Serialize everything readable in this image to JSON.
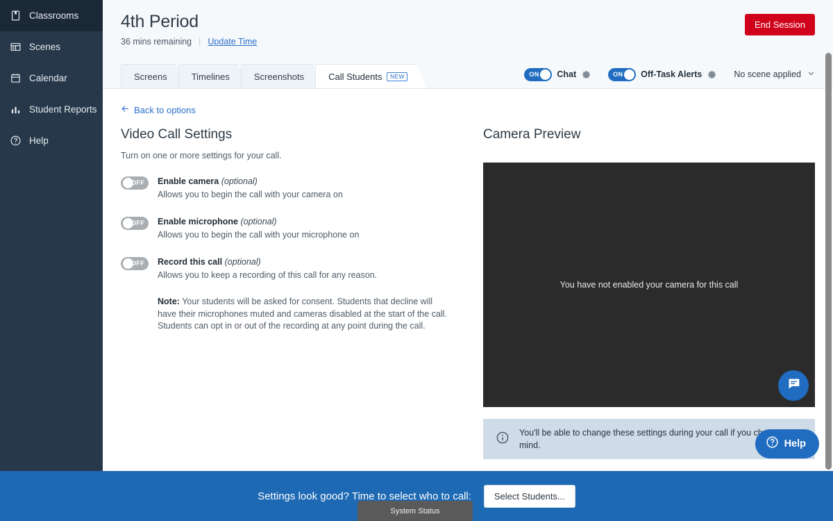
{
  "sidebar": {
    "items": [
      {
        "label": "Classrooms",
        "icon": "book-icon",
        "active": true
      },
      {
        "label": "Scenes",
        "icon": "scenes-icon",
        "active": false
      },
      {
        "label": "Calendar",
        "icon": "calendar-icon",
        "active": false
      },
      {
        "label": "Student Reports",
        "icon": "bar-chart-icon",
        "active": false
      },
      {
        "label": "Help",
        "icon": "question-circle-icon",
        "active": false
      }
    ]
  },
  "header": {
    "title": "4th Period",
    "time_remaining": "36 mins remaining",
    "separator": "|",
    "update_time_label": "Update Time",
    "end_session_label": "End Session"
  },
  "tabs": [
    {
      "label": "Screens",
      "active": false,
      "badge": ""
    },
    {
      "label": "Timelines",
      "active": false,
      "badge": ""
    },
    {
      "label": "Screenshots",
      "active": false,
      "badge": ""
    },
    {
      "label": "Call Students",
      "active": true,
      "badge": "NEW"
    }
  ],
  "tabbar_controls": {
    "chat_toggle": {
      "state": "ON",
      "label": "Chat",
      "on": true
    },
    "offtask_toggle": {
      "state": "ON",
      "label": "Off-Task Alerts",
      "on": true
    },
    "scene_select": {
      "value": "No scene applied",
      "caret": "chevron-down-icon"
    }
  },
  "content": {
    "back_link": "Back to options",
    "left": {
      "title": "Video Call Settings",
      "subtitle": "Turn on one or more settings for your call.",
      "settings": [
        {
          "toggle_state": "OFF",
          "on": false,
          "title": "Enable camera",
          "optional": "(optional)",
          "description": "Allows you to begin the call with your camera on"
        },
        {
          "toggle_state": "OFF",
          "on": false,
          "title": "Enable microphone",
          "optional": "(optional)",
          "description": "Allows you to begin the call with your microphone on"
        },
        {
          "toggle_state": "OFF",
          "on": false,
          "title": "Record this call",
          "optional": "(optional)",
          "description": "Allows you to keep a recording of this call for any reason."
        }
      ],
      "note_label": "Note:",
      "note_text": " Your students will be asked for consent. Students that decline will have their microphones muted and cameras disabled at the start of the call. Students can opt in or out of the recording at any point during the call."
    },
    "right": {
      "title": "Camera Preview",
      "camera_message": "You have not enabled your camera for this call",
      "info_text": "You'll be able to change these settings during your call if you change your mind."
    }
  },
  "bottom_bar": {
    "prompt": "Settings look good? Time to select who to call:",
    "select_students_label": "Select Students..."
  },
  "system_status": {
    "label": "System Status"
  },
  "help_fab": {
    "label": "Help"
  },
  "colors": {
    "sidebar_bg": "#27384a",
    "sidebar_active": "#1b2836",
    "accent_blue": "#1f6cc0",
    "link_blue": "#2a6fc9",
    "danger_red": "#d0021b",
    "bottom_bar_blue": "#1e69b4",
    "camera_bg": "#2b2b2b",
    "infobox_bg": "#cfdbe6",
    "topbar_bg": "#f6f9fc"
  }
}
